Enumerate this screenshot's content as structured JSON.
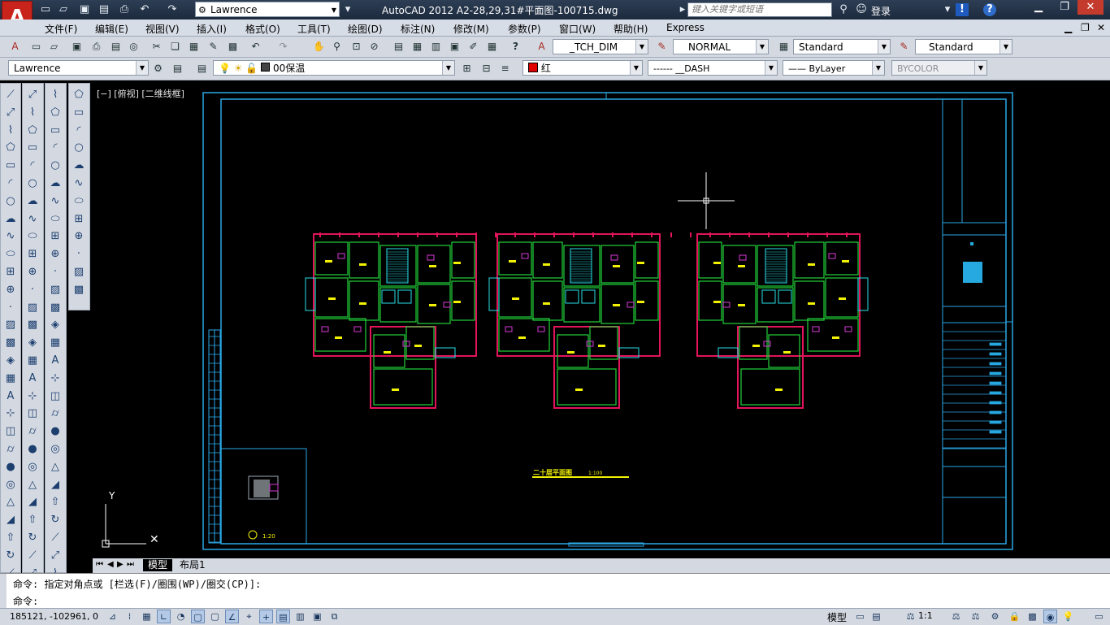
{
  "titlebar": {
    "workspace": "Lawrence",
    "title": "AutoCAD 2012    A2-28,29,31#平面图-100715.dwg",
    "search_placeholder": "键入关键字或短语",
    "login": "登录"
  },
  "menu": [
    "文件(F)",
    "编辑(E)",
    "视图(V)",
    "插入(I)",
    "格式(O)",
    "工具(T)",
    "绘图(D)",
    "标注(N)",
    "修改(M)",
    "参数(P)",
    "窗口(W)",
    "帮助(H)",
    "Express"
  ],
  "toolbar1": {
    "dim_style": "_TCH_DIM",
    "text_style": "NORMAL",
    "table_style": "Standard",
    "mleader_style": "Standard"
  },
  "toolbar2": {
    "workspace": "Lawrence",
    "layer": "00保温",
    "color": "红",
    "linetype": "------ __DASH",
    "lineweight": "—— ByLayer",
    "plotstyle": "BYCOLOR"
  },
  "viewport": {
    "label": "[−] [俯视] [二维线框]",
    "drawing_title": "二十层平面图",
    "drawing_scale": "1:100",
    "detail_scale": "1:20"
  },
  "tabs": {
    "model": "模型",
    "layout1": "布局1"
  },
  "command": {
    "history": "命令: 指定对角点或 [栏选(F)/圈围(WP)/圈交(CP)]:",
    "prompt": "命令:"
  },
  "status": {
    "coords": "185121, -102961, 0",
    "model": "模型",
    "annot_scale": "1:1"
  },
  "colors": {
    "frame": "#2aa7e6",
    "walls": "#e2145a",
    "green": "#22d33a",
    "yellow": "#f2f200",
    "cyan": "#26e0e8",
    "magenta": "#d63ad6"
  }
}
